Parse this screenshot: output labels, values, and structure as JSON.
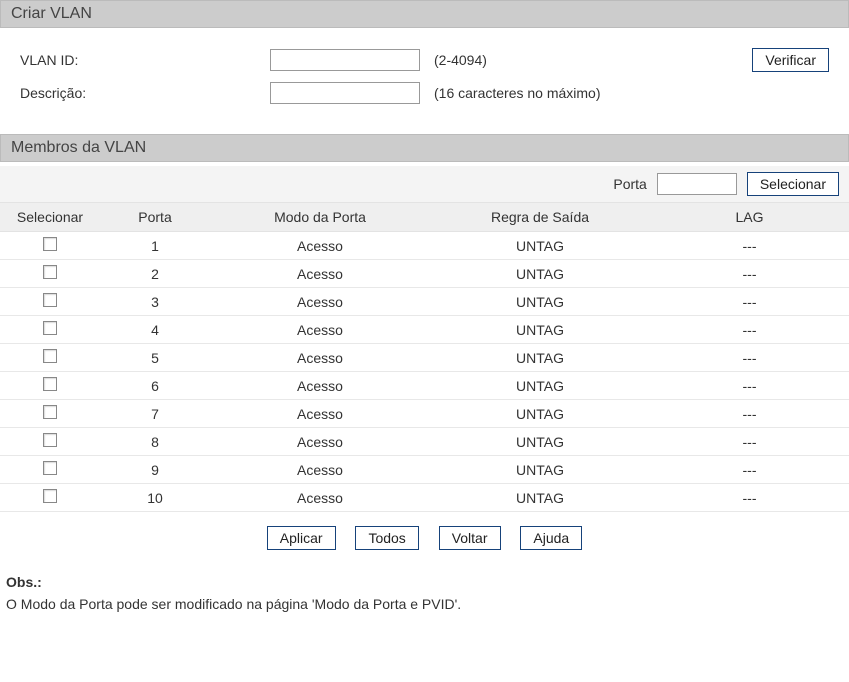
{
  "create": {
    "title": "Criar VLAN",
    "vlan_id_label": "VLAN ID:",
    "vlan_id_value": "",
    "vlan_id_hint": "(2-4094)",
    "desc_label": "Descrição:",
    "desc_value": "",
    "desc_hint": "(16 caracteres no máximo)",
    "verify_btn": "Verificar"
  },
  "members": {
    "title": "Membros da VLAN",
    "port_filter_label": "Porta",
    "port_filter_value": "",
    "select_btn": "Selecionar",
    "columns": {
      "select": "Selecionar",
      "port": "Porta",
      "mode": "Modo da Porta",
      "egress": "Regra de Saída",
      "lag": "LAG"
    },
    "rows": [
      {
        "port": "1",
        "mode": "Acesso",
        "egress": "UNTAG",
        "lag": "---"
      },
      {
        "port": "2",
        "mode": "Acesso",
        "egress": "UNTAG",
        "lag": "---"
      },
      {
        "port": "3",
        "mode": "Acesso",
        "egress": "UNTAG",
        "lag": "---"
      },
      {
        "port": "4",
        "mode": "Acesso",
        "egress": "UNTAG",
        "lag": "---"
      },
      {
        "port": "5",
        "mode": "Acesso",
        "egress": "UNTAG",
        "lag": "---"
      },
      {
        "port": "6",
        "mode": "Acesso",
        "egress": "UNTAG",
        "lag": "---"
      },
      {
        "port": "7",
        "mode": "Acesso",
        "egress": "UNTAG",
        "lag": "---"
      },
      {
        "port": "8",
        "mode": "Acesso",
        "egress": "UNTAG",
        "lag": "---"
      },
      {
        "port": "9",
        "mode": "Acesso",
        "egress": "UNTAG",
        "lag": "---"
      },
      {
        "port": "10",
        "mode": "Acesso",
        "egress": "UNTAG",
        "lag": "---"
      }
    ]
  },
  "actions": {
    "apply": "Aplicar",
    "all": "Todos",
    "back": "Voltar",
    "help": "Ajuda"
  },
  "note": {
    "title": "Obs.:",
    "text": "O Modo da Porta pode ser modificado na página 'Modo da Porta e PVID'."
  }
}
